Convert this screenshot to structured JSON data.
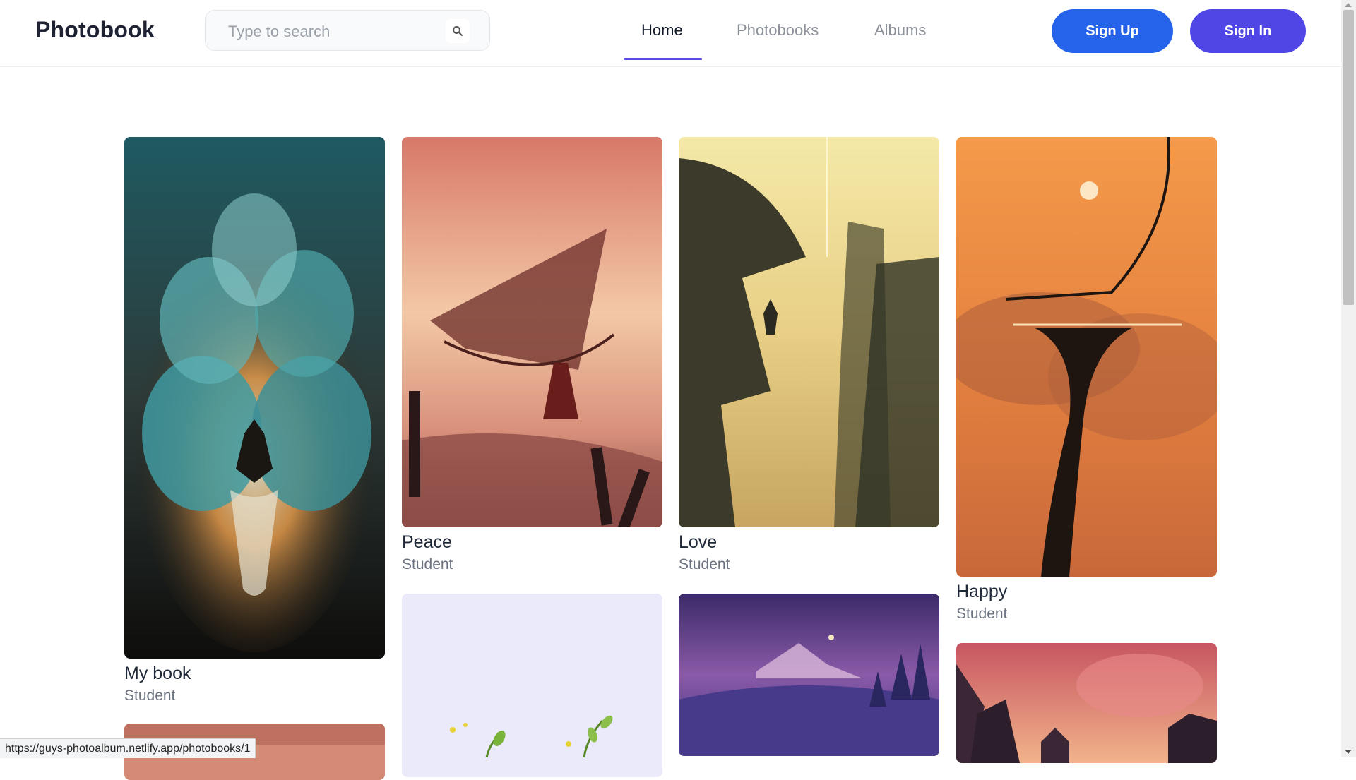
{
  "app": {
    "logo": "Photobook"
  },
  "search": {
    "placeholder": "Type to search",
    "icon": "search-icon"
  },
  "nav": {
    "items": [
      {
        "label": "Home",
        "active": true
      },
      {
        "label": "Photobooks",
        "active": false
      },
      {
        "label": "Albums",
        "active": false
      }
    ]
  },
  "auth": {
    "signup_label": "Sign Up",
    "signin_label": "Sign In"
  },
  "cards": [
    {
      "title": "My book",
      "subtitle": "Student"
    },
    {
      "title": "Peace",
      "subtitle": "Student"
    },
    {
      "title": "Love",
      "subtitle": "Student"
    },
    {
      "title": "Happy",
      "subtitle": "Student"
    },
    {
      "title": "",
      "subtitle": ""
    },
    {
      "title": "",
      "subtitle": ""
    },
    {
      "title": "",
      "subtitle": ""
    },
    {
      "title": "",
      "subtitle": ""
    }
  ],
  "status_bar": {
    "url": "https://guys-photoalbum.netlify.app/photobooks/1"
  },
  "colors": {
    "accent": "#4f46e5",
    "signup": "#2563eb",
    "text": "#111827",
    "muted": "#6b7280"
  }
}
